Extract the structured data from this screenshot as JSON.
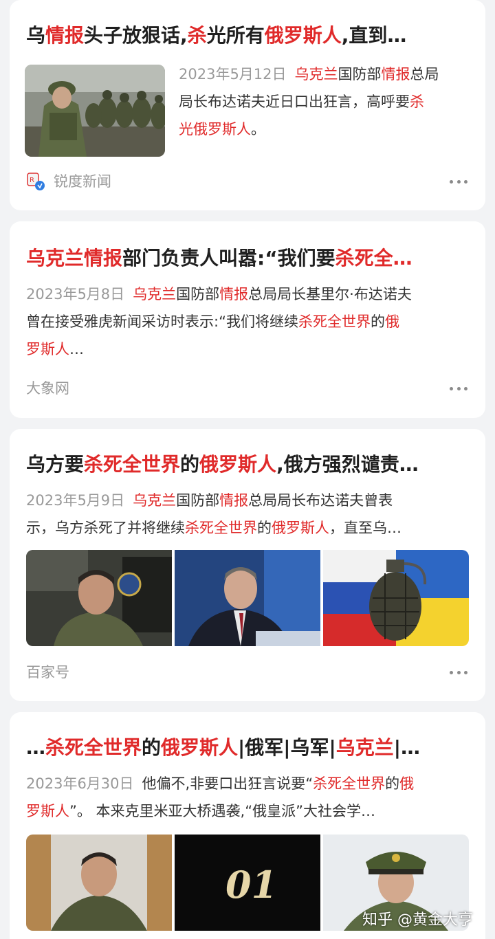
{
  "colors": {
    "background": "#f2f3f5",
    "card": "#ffffff",
    "highlight": "#e02a2a",
    "muted": "#999999"
  },
  "cards": [
    {
      "title": [
        "乌",
        "情报",
        "头子放狠话,",
        "杀",
        "光所有",
        "俄罗斯人",
        ",直到…"
      ],
      "date": "2023年5月12日",
      "snippet_line1": [
        "乌克兰",
        "国防部",
        "情报",
        "总局"
      ],
      "snippet_line2": "局长布达诺夫近日口出狂言，高呼要",
      "snippet_line2_hl": "杀",
      "snippet_line3_hl": "光俄罗斯人",
      "snippet_line3_end": "。",
      "source": "锐度新闻",
      "image": "soldiers-photo"
    },
    {
      "title": [
        "乌克兰情报",
        "部门负责人叫嚣:“我们要",
        "杀死全…"
      ],
      "date": "2023年5月8日",
      "snippet_a": [
        "乌克兰",
        "国防部",
        "情报",
        "总局局长基里尔·布达诺夫"
      ],
      "snippet_b": [
        "曾在接受雅虎新闻采访时表示:“我们将继续",
        "杀死全世界",
        "的",
        "俄"
      ],
      "snippet_c": [
        "罗斯人",
        "…"
      ],
      "source": "大象网"
    },
    {
      "title": [
        "乌方要",
        "杀死全世界",
        "的",
        "俄罗斯人",
        ",俄方强烈谴责…"
      ],
      "date": "2023年5月9日",
      "snippet_a": [
        "乌克兰",
        "国防部",
        "情报",
        "总局局长布达诺夫曾表"
      ],
      "snippet_b": [
        "示，乌方杀死了并将继续",
        "杀死全世界",
        "的",
        "俄罗斯人",
        "，直至乌…"
      ],
      "source": "百家号",
      "images": [
        "budanov-portrait",
        "peskov-portrait",
        "grenade-flags"
      ]
    },
    {
      "title": [
        "…",
        "杀死全世界",
        "的",
        "俄罗斯人",
        "|俄军|乌军|",
        "乌克兰",
        "|…"
      ],
      "date": "2023年6月30日",
      "snippet_a": [
        "他偏不,非要口出狂言说要“",
        "杀死全世界",
        "的",
        "俄"
      ],
      "snippet_b": [
        "罗斯人",
        "”。 本来克里米亚大桥遇袭,“俄皇派”大社会学…"
      ],
      "images": [
        "budanov-video",
        "number-01",
        "officer-cap"
      ],
      "number_text": "01",
      "watermark": "知乎 @黄金大亨"
    }
  ]
}
